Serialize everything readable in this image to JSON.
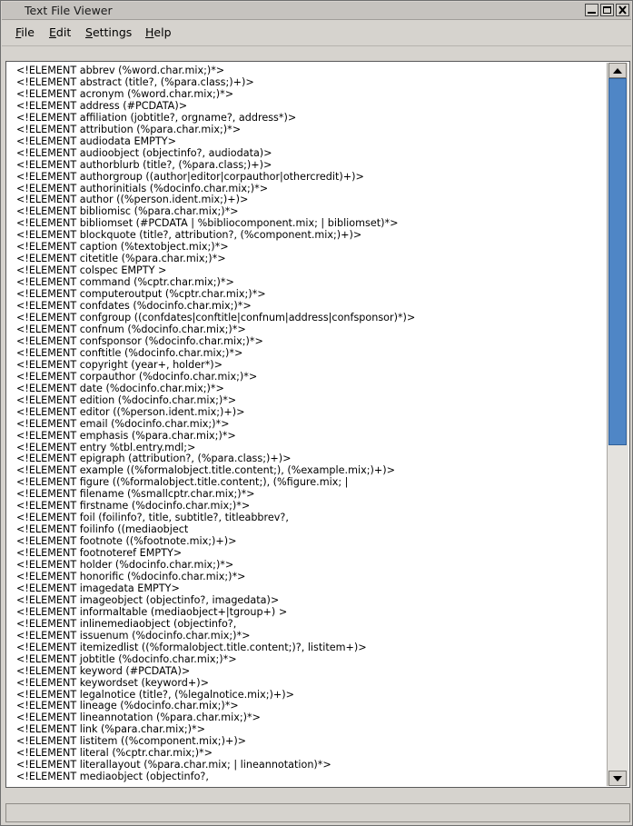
{
  "window": {
    "title": "Text File Viewer"
  },
  "menu": [
    {
      "label": "File",
      "underline": "F",
      "rest": "ile"
    },
    {
      "label": "Edit",
      "underline": "E",
      "rest": "dit"
    },
    {
      "label": "Settings",
      "underline": "S",
      "rest": "ettings"
    },
    {
      "label": "Help",
      "underline": "H",
      "rest": "elp"
    }
  ],
  "lines": [
    "<!ELEMENT abbrev (%word.char.mix;)*>",
    "<!ELEMENT abstract (title?, (%para.class;)+)>",
    "<!ELEMENT acronym (%word.char.mix;)*>",
    "<!ELEMENT address (#PCDATA)>",
    "<!ELEMENT affiliation (jobtitle?, orgname?, address*)>",
    "<!ELEMENT attribution (%para.char.mix;)*>",
    "<!ELEMENT audiodata EMPTY>",
    "<!ELEMENT audioobject (objectinfo?, audiodata)>",
    "<!ELEMENT authorblurb (title?, (%para.class;)+)>",
    "<!ELEMENT authorgroup ((author|editor|corpauthor|othercredit)+)>",
    "<!ELEMENT authorinitials (%docinfo.char.mix;)*>",
    "<!ELEMENT author ((%person.ident.mix;)+)>",
    "<!ELEMENT bibliomisc (%para.char.mix;)*>",
    "<!ELEMENT bibliomset (#PCDATA | %bibliocomponent.mix; | bibliomset)*>",
    "<!ELEMENT blockquote (title?, attribution?, (%component.mix;)+)>",
    "<!ELEMENT caption (%textobject.mix;)*>",
    "<!ELEMENT citetitle (%para.char.mix;)*>",
    "<!ELEMENT colspec EMPTY >",
    "<!ELEMENT command (%cptr.char.mix;)*>",
    "<!ELEMENT computeroutput (%cptr.char.mix;)*>",
    "<!ELEMENT confdates (%docinfo.char.mix;)*>",
    "<!ELEMENT confgroup ((confdates|conftitle|confnum|address|confsponsor)*)>",
    "<!ELEMENT confnum (%docinfo.char.mix;)*>",
    "<!ELEMENT confsponsor (%docinfo.char.mix;)*>",
    "<!ELEMENT conftitle (%docinfo.char.mix;)*>",
    "<!ELEMENT copyright (year+, holder*)>",
    "<!ELEMENT corpauthor (%docinfo.char.mix;)*>",
    "<!ELEMENT date (%docinfo.char.mix;)*>",
    "<!ELEMENT edition (%docinfo.char.mix;)*>",
    "<!ELEMENT editor ((%person.ident.mix;)+)>",
    "<!ELEMENT email (%docinfo.char.mix;)*>",
    "<!ELEMENT emphasis (%para.char.mix;)*>",
    "<!ELEMENT entry %tbl.entry.mdl;>",
    "<!ELEMENT epigraph (attribution?, (%para.class;)+)>",
    "<!ELEMENT example ((%formalobject.title.content;), (%example.mix;)+)>",
    "<!ELEMENT figure ((%formalobject.title.content;), (%figure.mix; |",
    "<!ELEMENT filename (%smallcptr.char.mix;)*>",
    "<!ELEMENT firstname (%docinfo.char.mix;)*>",
    "<!ELEMENT foil (foilinfo?, title, subtitle?, titleabbrev?,",
    "<!ELEMENT foilinfo ((mediaobject",
    "<!ELEMENT footnote ((%footnote.mix;)+)>",
    "<!ELEMENT footnoteref EMPTY>",
    "<!ELEMENT holder (%docinfo.char.mix;)*>",
    "<!ELEMENT honorific (%docinfo.char.mix;)*>",
    "<!ELEMENT imagedata EMPTY>",
    "<!ELEMENT imageobject (objectinfo?, imagedata)>",
    "<!ELEMENT informaltable (mediaobject+|tgroup+) >",
    "<!ELEMENT inlinemediaobject (objectinfo?,",
    "<!ELEMENT issuenum (%docinfo.char.mix;)*>",
    "<!ELEMENT itemizedlist ((%formalobject.title.content;)?, listitem+)>",
    "<!ELEMENT jobtitle (%docinfo.char.mix;)*>",
    "<!ELEMENT keyword (#PCDATA)>",
    "<!ELEMENT keywordset (keyword+)>",
    "<!ELEMENT legalnotice (title?, (%legalnotice.mix;)+)>",
    "<!ELEMENT lineage (%docinfo.char.mix;)*>",
    "<!ELEMENT lineannotation (%para.char.mix;)*>",
    "<!ELEMENT link (%para.char.mix;)*>",
    "<!ELEMENT listitem ((%component.mix;)+)>",
    "<!ELEMENT literal (%cptr.char.mix;)*>",
    "<!ELEMENT literallayout (%para.char.mix; | lineannotation)*>",
    "<!ELEMENT mediaobject (objectinfo?,"
  ],
  "scrollbar": {
    "position": 0.0,
    "visible_fraction": 0.53
  },
  "status": {
    "text": ""
  },
  "colors": {
    "thumb": "#4f86c6",
    "chrome": "#d6d3ce"
  },
  "icons": [
    "minimize-icon",
    "maximize-icon",
    "close-icon",
    "arrow-up-icon",
    "arrow-down-icon"
  ]
}
